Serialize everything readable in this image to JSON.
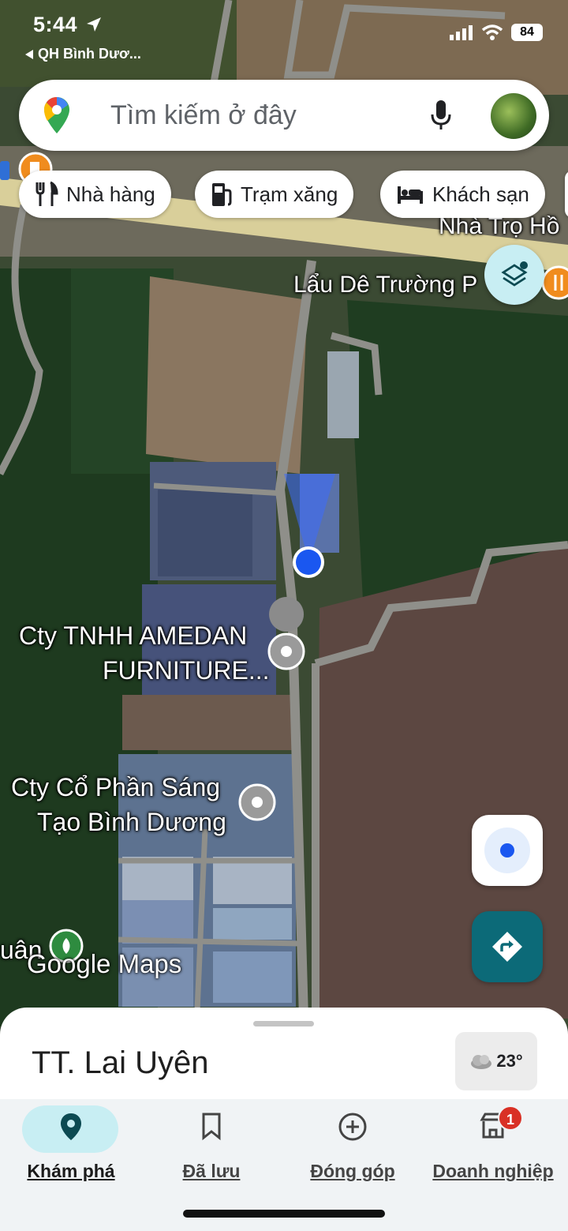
{
  "status": {
    "time": "5:44",
    "location_back": "QH Bình Dươ...",
    "battery": "84"
  },
  "search": {
    "placeholder": "Tìm kiếm ở đây"
  },
  "chips": [
    {
      "label": "Nhà hàng",
      "icon": "restaurant-icon"
    },
    {
      "label": "Trạm xăng",
      "icon": "gas-station-icon"
    },
    {
      "label": "Khách sạn",
      "icon": "hotel-icon"
    }
  ],
  "map": {
    "labels": {
      "nha_tro": "Nhà Trọ Hồ",
      "lau_de": "Lẩu Dê Trường P",
      "amedan_1": "Cty TNHH AMEDAN",
      "amedan_2": "FURNITURE...",
      "sang_tao_1": "Cty Cổ Phần Sáng",
      "sang_tao_2": "Tạo Bình Dương",
      "edge_left": "uân"
    },
    "watermark": "Google Maps"
  },
  "sheet": {
    "title": "TT. Lai Uyên",
    "temperature": "23°",
    "weather_icon": "cloud-icon"
  },
  "nav": [
    {
      "label": "Khám phá",
      "icon": "place-icon",
      "active": true
    },
    {
      "label": "Đã lưu",
      "icon": "bookmark-icon"
    },
    {
      "label": "Đóng góp",
      "icon": "add-circle-icon"
    },
    {
      "label": "Doanh nghiệp",
      "icon": "store-icon",
      "badge": "1"
    }
  ],
  "colors": {
    "accent": "#0c6a78",
    "active_pill": "#c8eef3",
    "user_dot": "#1a57f0"
  }
}
